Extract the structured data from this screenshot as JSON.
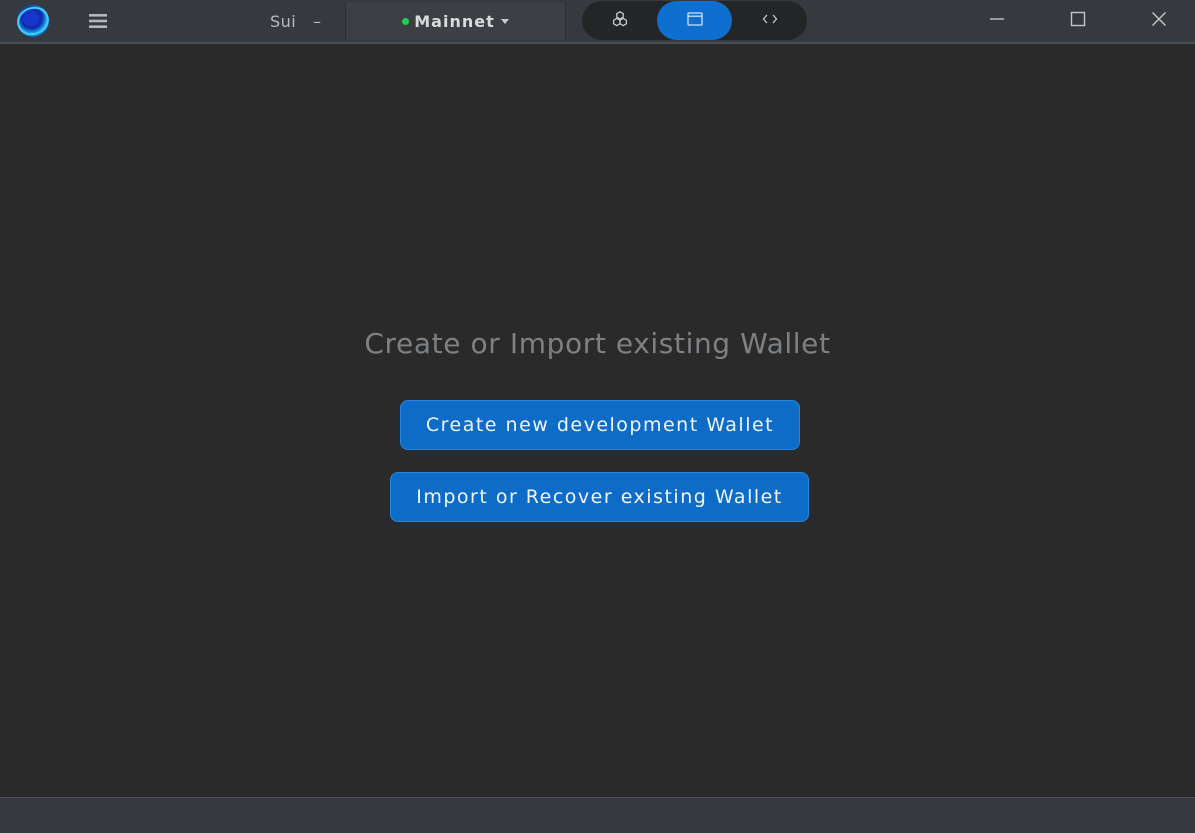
{
  "titlebar": {
    "chain_label": "Sui",
    "chain_separator": "–",
    "network": {
      "name": "Mainnet",
      "status_color": "#1ed14b"
    },
    "view_modes": [
      {
        "icon": "packages-icon",
        "active": false
      },
      {
        "icon": "window-icon",
        "active": true
      },
      {
        "icon": "code-icon",
        "active": false
      }
    ],
    "window_controls": [
      "minimize-icon",
      "maximize-icon",
      "close-icon"
    ]
  },
  "main": {
    "heading": "Create or Import existing Wallet",
    "create_button": "Create new development Wallet",
    "import_button": "Import or Recover existing Wallet"
  },
  "colors": {
    "accent": "#0d6cc7",
    "background": "#2a2a2a",
    "titlebar": "#363a3e"
  }
}
